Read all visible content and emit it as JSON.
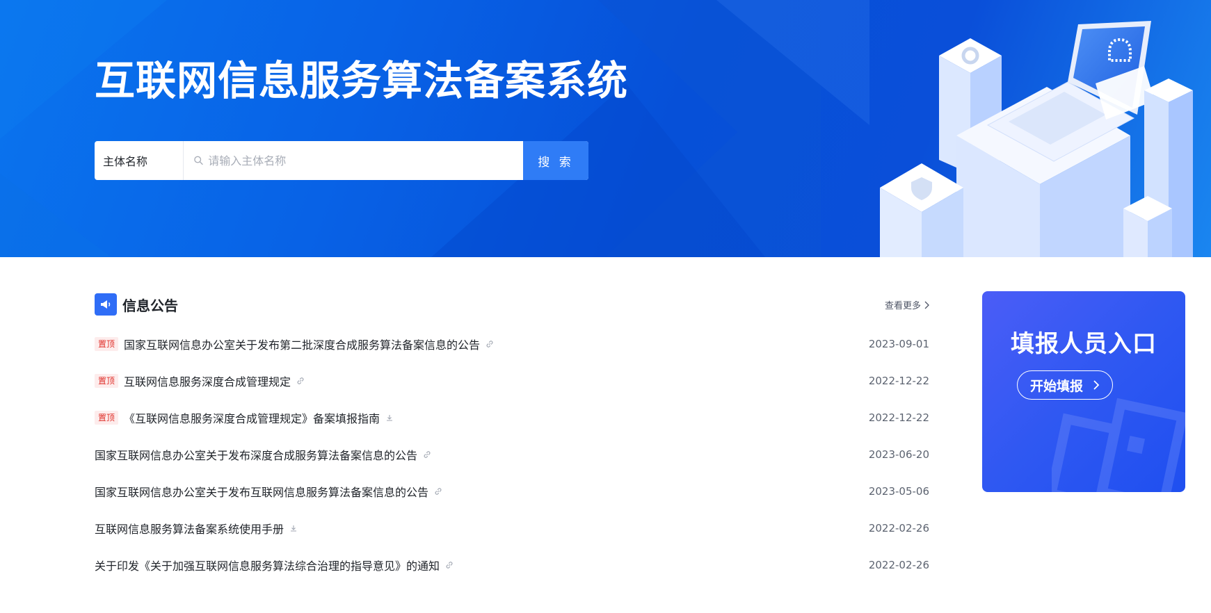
{
  "banner": {
    "title": "互联网信息服务算法备案系统",
    "search": {
      "select_label": "主体名称",
      "placeholder": "请输入主体名称",
      "button_label": "搜 索"
    }
  },
  "notices": {
    "title": "信息公告",
    "more_label": "查看更多",
    "pin_label": "置顶",
    "items": [
      {
        "text": "国家互联网信息办公室关于发布第二批深度合成服务算法备案信息的公告",
        "date": "2023-09-01",
        "pinned": true,
        "icon": "link-icon"
      },
      {
        "text": "互联网信息服务深度合成管理规定",
        "date": "2022-12-22",
        "pinned": true,
        "icon": "link-icon"
      },
      {
        "text": "《互联网信息服务深度合成管理规定》备案填报指南",
        "date": "2022-12-22",
        "pinned": true,
        "icon": "download-icon"
      },
      {
        "text": "国家互联网信息办公室关于发布深度合成服务算法备案信息的公告",
        "date": "2023-06-20",
        "pinned": false,
        "icon": "link-icon"
      },
      {
        "text": "国家互联网信息办公室关于发布互联网信息服务算法备案信息的公告",
        "date": "2023-05-06",
        "pinned": false,
        "icon": "link-icon"
      },
      {
        "text": "互联网信息服务算法备案系统使用手册",
        "date": "2022-02-26",
        "pinned": false,
        "icon": "download-icon"
      },
      {
        "text": "关于印发《关于加强互联网信息服务算法综合治理的指导意见》的通知",
        "date": "2022-02-26",
        "pinned": false,
        "icon": "link-icon"
      }
    ]
  },
  "entry": {
    "title": "填报人员入口",
    "button_label": "开始填报"
  },
  "colors": {
    "primary": "#2f7cf6",
    "banner_blue": "#0650d8",
    "pin_red": "#e0312b",
    "card_blue": "#2f58f2"
  }
}
